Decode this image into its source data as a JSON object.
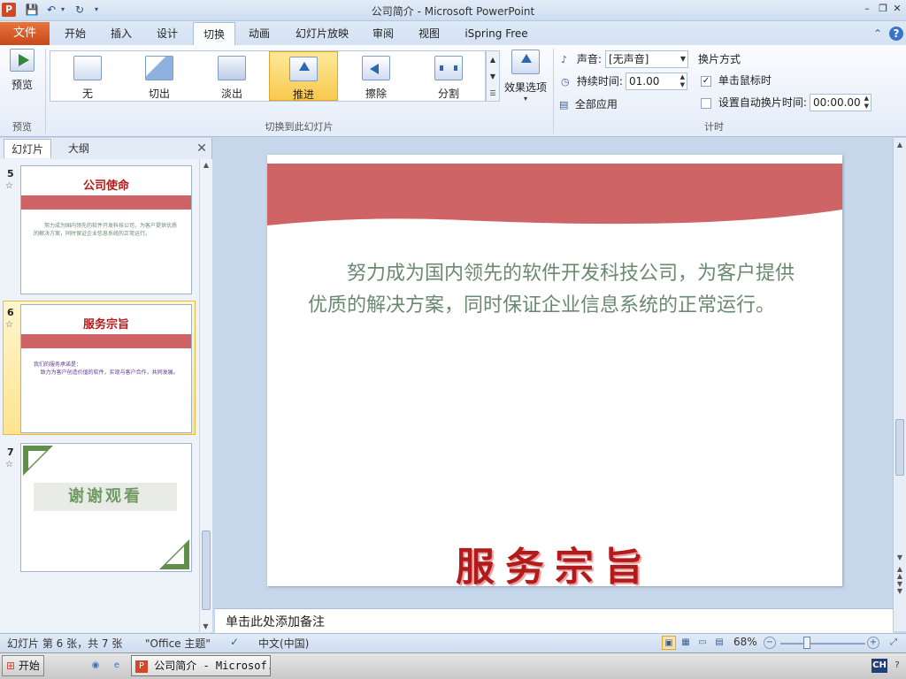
{
  "window": {
    "title": "公司简介 - Microsoft PowerPoint",
    "app_icon_letter": "P"
  },
  "qat": {
    "save": "💾",
    "undo": "↶",
    "undo_more": "▾",
    "redo": "↻",
    "customize": "▾"
  },
  "window_buttons": {
    "minimize": "–",
    "restore": "❐",
    "close": "✕"
  },
  "ribbon_tabs": {
    "file": "文件",
    "tabs": [
      "开始",
      "插入",
      "设计",
      "切换",
      "动画",
      "幻灯片放映",
      "审阅",
      "视图",
      "iSpring Free"
    ],
    "active_index": 3,
    "collapse": "⌃",
    "help": "?"
  },
  "ribbon": {
    "preview_group": {
      "button": "预览",
      "label": "预览"
    },
    "transition_group": {
      "label": "切换到此幻灯片",
      "items": [
        "无",
        "切出",
        "淡出",
        "推进",
        "擦除",
        "分割"
      ],
      "selected_index": 3,
      "effects_button": "效果选项"
    },
    "timing_group": {
      "label": "计时",
      "sound_label": "声音:",
      "sound_value": "[无声音]",
      "duration_label": "持续时间:",
      "duration_value": "01.00",
      "apply_all": "全部应用",
      "advance_header": "换片方式",
      "on_click_label": "单击鼠标时",
      "on_click_checked": true,
      "auto_after_label": "设置自动换片时间:",
      "auto_after_value": "00:00.00",
      "auto_after_checked": false
    }
  },
  "slides_panel": {
    "tabs": [
      "幻灯片",
      "大纲"
    ],
    "active_tab": 0,
    "close": "✕",
    "slides": [
      {
        "number": "5",
        "title": "公司使命",
        "body": "努力成为国内领先的软件开发科技公司，为客户提供优质的解决方案，同时保证企业信息系统的正常运行。"
      },
      {
        "number": "6",
        "title": "服务宗旨",
        "body": "我们的服务承诺是：\n    致力为客户创造价值的软件，实现与客户合作，共同发展。"
      },
      {
        "number": "7",
        "title": "谢谢观看"
      }
    ],
    "selected_index": 1
  },
  "slide": {
    "body": "努力成为国内领先的软件开发科技公司，为客户提供优质的解决方案，同时保证企业信息系统的正常运行。",
    "title": "服务宗旨",
    "banner_color": "#cf6467"
  },
  "notes": {
    "placeholder": "单击此处添加备注"
  },
  "status": {
    "slide_info": "幻灯片 第 6 张，共 7 张",
    "theme": "\"Office 主题\"",
    "language": "中文(中国)",
    "zoom": "68%",
    "zoom_minus": "−",
    "zoom_plus": "+"
  },
  "taskbar": {
    "start": "开始",
    "task_item": "公司简介 - Microsof...",
    "ime": "CH"
  }
}
